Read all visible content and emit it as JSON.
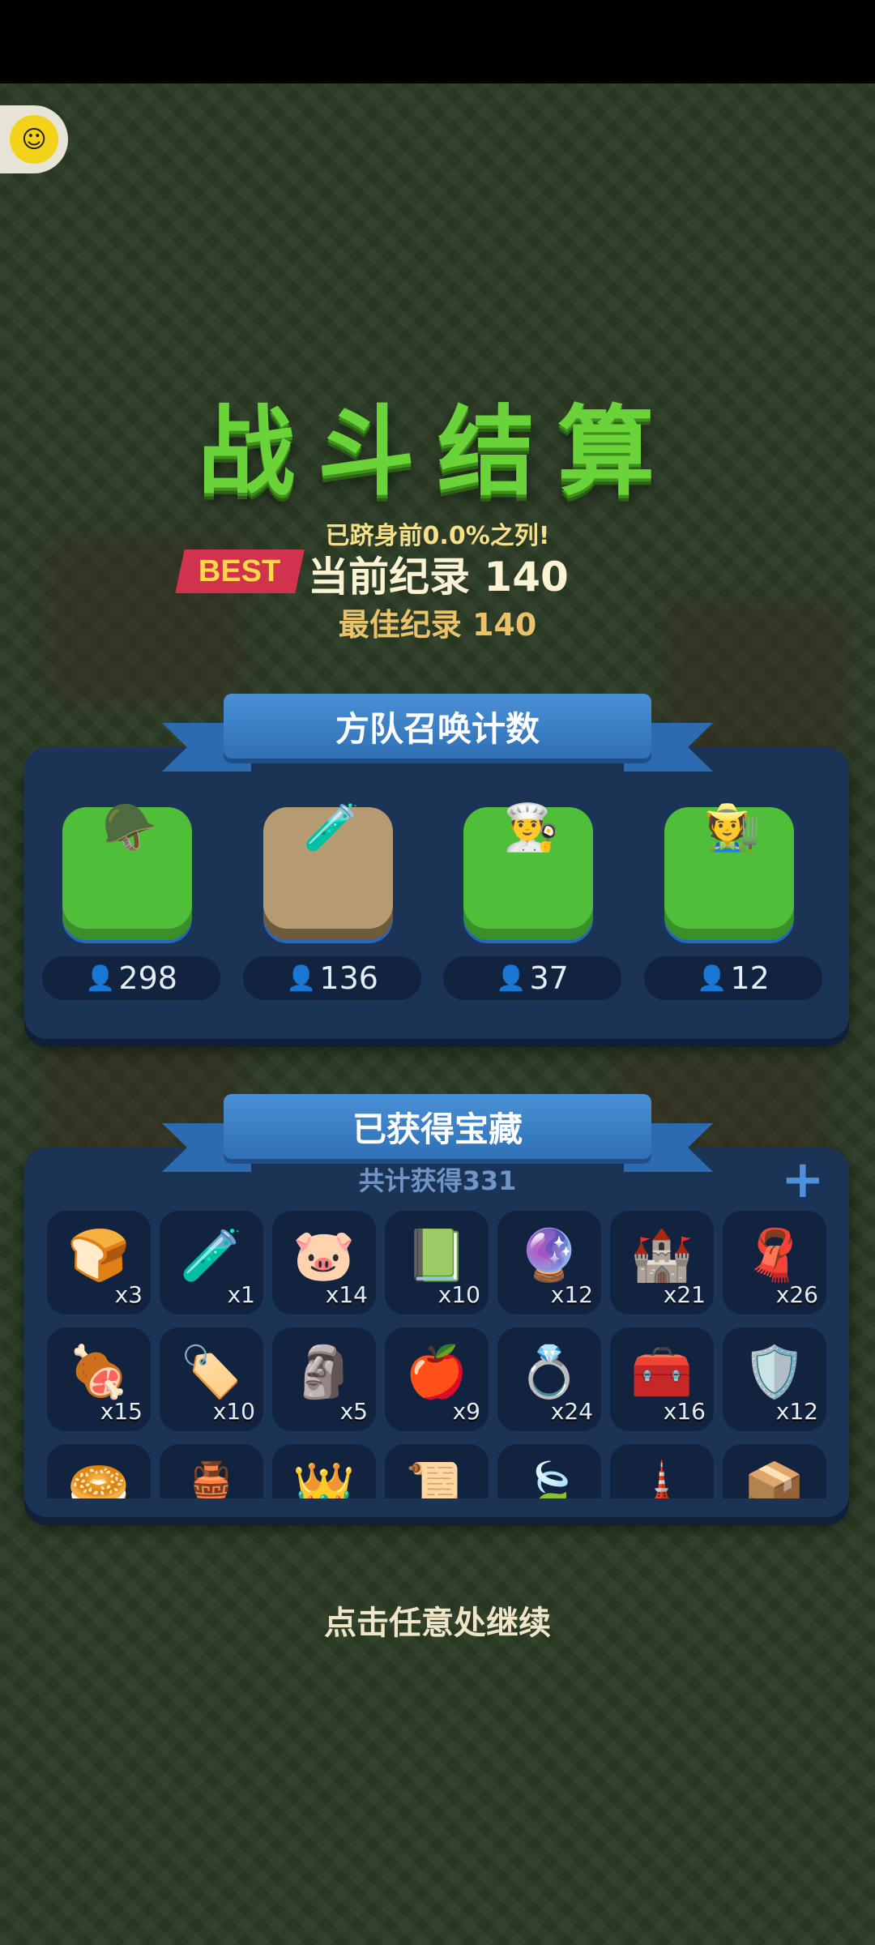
{
  "title": "战斗结算",
  "rank_text": "已跻身前0.0%之列!",
  "best_badge": "BEST",
  "current_record": "当前纪录 140",
  "best_record": "最佳纪录 140",
  "squad_panel": {
    "title": "方队召唤计数",
    "troops": [
      {
        "unit": "knight",
        "icon": "🪖",
        "count": "298",
        "tile": "grass"
      },
      {
        "unit": "alchemist",
        "icon": "🧪",
        "count": "136",
        "tile": "stone"
      },
      {
        "unit": "chef",
        "icon": "👨‍🍳",
        "count": "37",
        "tile": "grass"
      },
      {
        "unit": "farmer",
        "icon": "🧑‍🌾",
        "count": "12",
        "tile": "grass"
      }
    ]
  },
  "treasure_panel": {
    "title": "已获得宝藏",
    "total": "共计获得331",
    "plus": "+",
    "items": [
      {
        "name": "bread",
        "icon": "🍞",
        "qty": "x3"
      },
      {
        "name": "potion",
        "icon": "🧪",
        "qty": "x1"
      },
      {
        "name": "piggy-bank",
        "icon": "🐷",
        "qty": "x14"
      },
      {
        "name": "book",
        "icon": "📗",
        "qty": "x10"
      },
      {
        "name": "crystal-ball",
        "icon": "🔮",
        "qty": "x12"
      },
      {
        "name": "banner",
        "icon": "🏰",
        "qty": "x21"
      },
      {
        "name": "cloth",
        "icon": "🧣",
        "qty": "x26"
      },
      {
        "name": "ham",
        "icon": "🍖",
        "qty": "x15"
      },
      {
        "name": "tag",
        "icon": "🏷️",
        "qty": "x10"
      },
      {
        "name": "statue",
        "icon": "🗿",
        "qty": "x5"
      },
      {
        "name": "apple",
        "icon": "🍎",
        "qty": "x9"
      },
      {
        "name": "ring",
        "icon": "💍",
        "qty": "x24"
      },
      {
        "name": "medkit",
        "icon": "🧰",
        "qty": "x16"
      },
      {
        "name": "shield",
        "icon": "🛡️",
        "qty": "x12"
      },
      {
        "name": "buns",
        "icon": "🥯",
        "qty": ""
      },
      {
        "name": "vase",
        "icon": "🏺",
        "qty": ""
      },
      {
        "name": "crown-helmet",
        "icon": "👑",
        "qty": ""
      },
      {
        "name": "document",
        "icon": "📜",
        "qty": ""
      },
      {
        "name": "leaf",
        "icon": "🍃",
        "qty": ""
      },
      {
        "name": "tower",
        "icon": "🗼",
        "qty": ""
      },
      {
        "name": "box",
        "icon": "📦",
        "qty": ""
      }
    ]
  },
  "continue_text": "点击任意处继续"
}
